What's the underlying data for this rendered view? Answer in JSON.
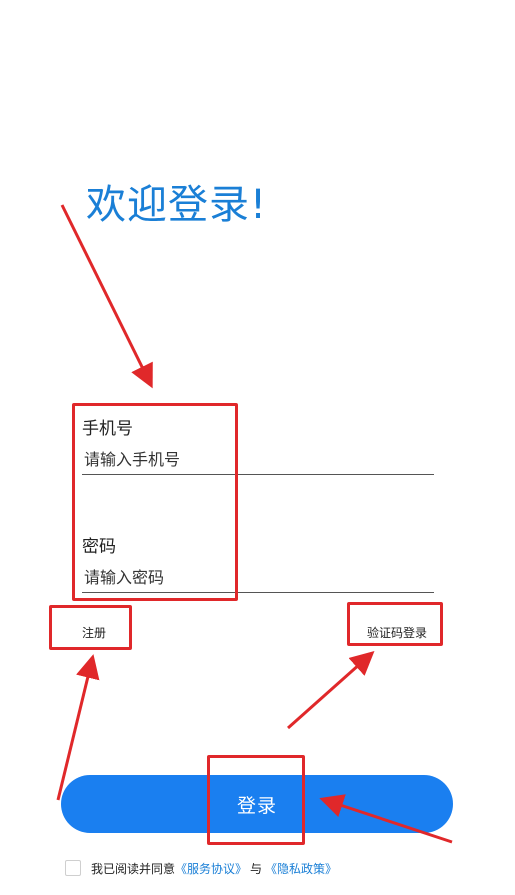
{
  "title": "欢迎登录!",
  "phone": {
    "label": "手机号",
    "placeholder": "请输入手机号"
  },
  "password": {
    "label": "密码",
    "placeholder": "请输入密码"
  },
  "links": {
    "register": "注册",
    "code_login": "验证码登录"
  },
  "login_button": "登录",
  "agreement": {
    "prefix": "我已阅读并同意",
    "service": "《服务协议》",
    "joiner": "与",
    "privacy": "《隐私政策》"
  },
  "colors": {
    "accent": "#1a7ff0",
    "title": "#1a7fd6",
    "annotation": "#e0282a"
  }
}
